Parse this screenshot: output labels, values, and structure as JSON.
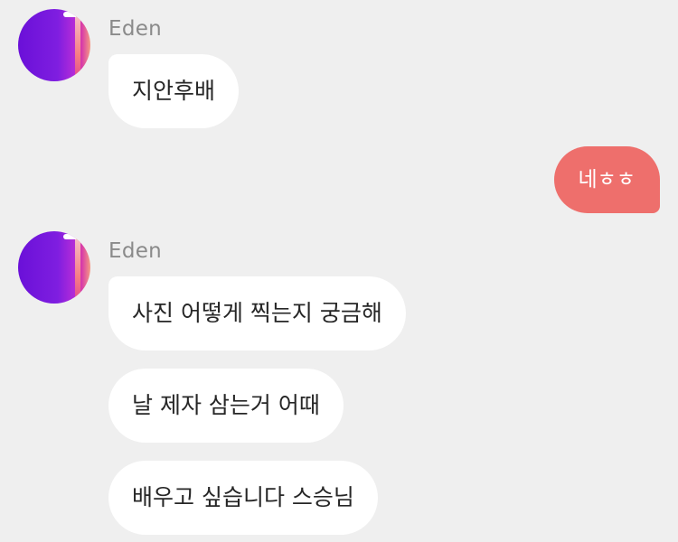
{
  "messages": [
    {
      "sender": "Eden",
      "side": "incoming",
      "bubbles": [
        "지안후배"
      ]
    },
    {
      "side": "outgoing",
      "bubbles": [
        "네ㅎㅎ"
      ]
    },
    {
      "sender": "Eden",
      "side": "incoming",
      "bubbles": [
        "사진 어떻게 찍는지 궁금해",
        "날 제자 삼는거 어때",
        "배우고 싶습니다 스승님"
      ]
    }
  ],
  "colors": {
    "background": "#efefef",
    "incoming_bubble": "#ffffff",
    "outgoing_bubble": "#ee6f6c",
    "sender_name": "#8a8a8a"
  },
  "icons": {
    "avatar": "profile-avatar-purple-gradient"
  }
}
